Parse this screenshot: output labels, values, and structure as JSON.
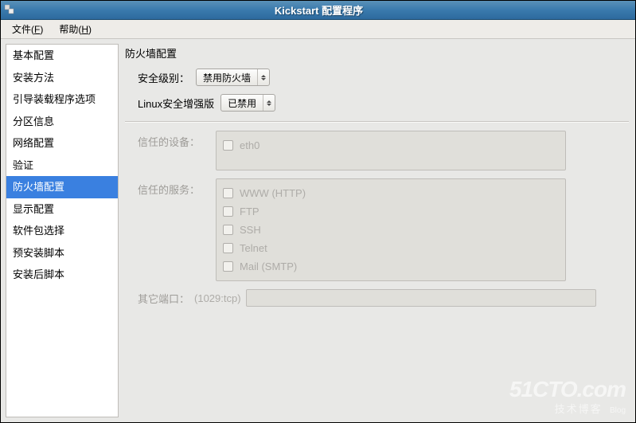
{
  "titlebar": {
    "title": "Kickstart 配置程序"
  },
  "menubar": {
    "file": "文件",
    "file_key": "F",
    "help": "帮助",
    "help_key": "H"
  },
  "sidebar": {
    "items": [
      "基本配置",
      "安装方法",
      "引导装载程序选项",
      "分区信息",
      "网络配置",
      "验证",
      "防火墙配置",
      "显示配置",
      "软件包选择",
      "预安装脚本",
      "安装后脚本"
    ],
    "selected_index": 6
  },
  "main": {
    "section_title": "防火墙配置",
    "security_level": {
      "label": "安全级别：",
      "value": "禁用防火墙"
    },
    "selinux": {
      "label": "Linux安全增强版",
      "value": "已禁用"
    },
    "trusted_devices": {
      "label": "信任的设备：",
      "items": [
        "eth0"
      ]
    },
    "trusted_services": {
      "label": "信任的服务：",
      "items": [
        "WWW (HTTP)",
        "FTP",
        "SSH",
        "Telnet",
        "Mail (SMTP)"
      ]
    },
    "other_ports": {
      "label": "其它端口：",
      "hint": "(1029:tcp)"
    }
  },
  "watermark": {
    "main": "51CTO.com",
    "sub": "技术博客",
    "blog": "Blog"
  }
}
